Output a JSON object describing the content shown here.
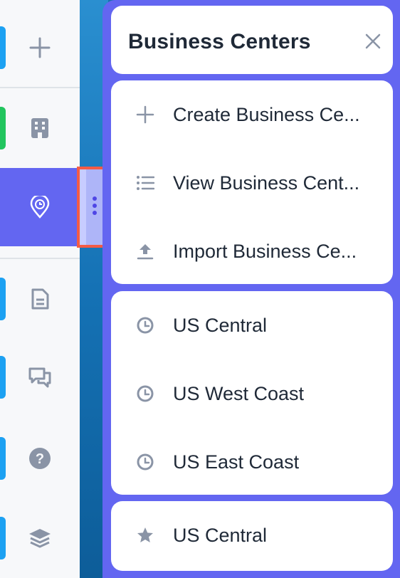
{
  "panel": {
    "title": "Business Centers",
    "close_icon": "close-icon"
  },
  "actions": [
    {
      "label": "Create Business Ce...",
      "icon": "plus-icon"
    },
    {
      "label": "View Business Cent...",
      "icon": "list-icon"
    },
    {
      "label": "Import Business Ce...",
      "icon": "upload-icon"
    }
  ],
  "centers": [
    {
      "label": "US Central",
      "icon": "clock-icon"
    },
    {
      "label": "US West Coast",
      "icon": "clock-icon"
    },
    {
      "label": "US East Coast",
      "icon": "clock-icon"
    }
  ],
  "favorites": [
    {
      "label": "US Central",
      "icon": "star-icon"
    }
  ],
  "sidebar": {
    "items": [
      {
        "icon": "plus-icon",
        "accent": "#1da1f2"
      },
      {
        "icon": "building-icon",
        "accent": "#22c55e"
      },
      {
        "icon": "location-clock-icon",
        "accent": "#6366f1",
        "active": true
      },
      {
        "icon": "document-icon",
        "accent": "#1da1f2"
      },
      {
        "icon": "chat-icon",
        "accent": "#1da1f2"
      },
      {
        "icon": "help-icon",
        "accent": "#1da1f2"
      },
      {
        "icon": "layers-icon",
        "accent": "#1da1f2"
      }
    ]
  },
  "colors": {
    "panel_bg": "#6366f1",
    "highlight": "#f45b45",
    "icon_gray": "#8a94a6"
  }
}
